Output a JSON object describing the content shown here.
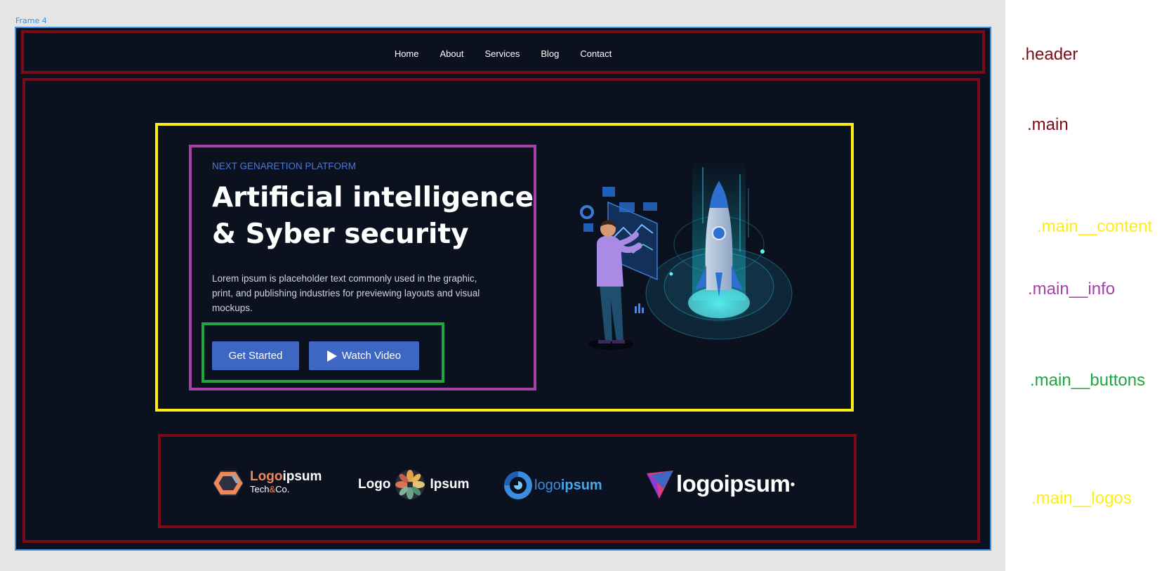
{
  "canvas": {
    "frame_label": "Frame 4"
  },
  "header": {
    "nav": [
      "Home",
      "About",
      "Services",
      "Blog",
      "Contact"
    ]
  },
  "main": {
    "info": {
      "eyebrow": "NEXT GENARETION PLATFORM",
      "headline_line1": "Artificial intelligence",
      "headline_line2": "& Syber security",
      "description": "Lorem ipsum is placeholder text commonly used in the graphic, print, and publishing industries for previewing layouts and visual mockups."
    },
    "buttons": {
      "primary_label": "Get Started",
      "secondary_label": "Watch Video"
    },
    "logos": {
      "logo1_part1": "Logo",
      "logo1_part2": "ipsum",
      "logo1_sub1": "Tech",
      "logo1_sub2": "&",
      "logo1_sub3": "Co.",
      "logo2_left": "Logo",
      "logo2_right": "Ipsum",
      "logo3_part1": "logo",
      "logo3_part2": "ipsum",
      "logo4_text": "logoipsum"
    }
  },
  "legend": {
    "header": ".header",
    "main": ".main",
    "content": ".main__content",
    "info": ".main__info",
    "buttons": ".main__buttons",
    "logos": ".main__logos"
  },
  "colors": {
    "background": "#0b111f",
    "accent_blue": "#3d67c2",
    "header_outline": "#7b0b17",
    "content_outline": "#ffee14",
    "info_outline": "#a541a5",
    "buttons_outline": "#1fa63f"
  }
}
